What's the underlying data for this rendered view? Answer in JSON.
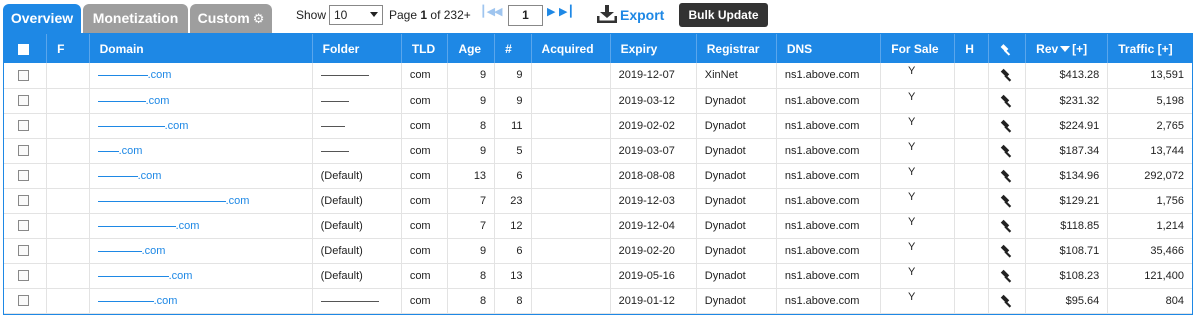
{
  "tabs": [
    {
      "label": "Overview",
      "active": true
    },
    {
      "label": "Monetization",
      "active": false
    },
    {
      "label": "Custom",
      "active": false
    }
  ],
  "toolbar": {
    "show_label": "Show",
    "show_value": "10",
    "page_prefix": "Page",
    "page_current": "1",
    "page_suffix": "of 232+",
    "page_input": "1",
    "export_label": "Export",
    "bulk_label": "Bulk Update"
  },
  "columns": [
    "F",
    "Domain",
    "Folder",
    "TLD",
    "Age",
    "#",
    "Acquired",
    "Expiry",
    "Registrar",
    "DNS",
    "For Sale",
    "H",
    "Rev",
    "[+]",
    "Traffic [+]"
  ],
  "rows": [
    {
      "domain_tld": ".com",
      "folder": "",
      "tld": "com",
      "age": "9",
      "count": "9",
      "acquired": "",
      "expiry": "2019-12-07",
      "registrar": "XinNet",
      "dns": "ns1.above.com",
      "for_sale": "Y",
      "rev": "$413.28",
      "traffic": "13,591"
    },
    {
      "domain_tld": ".com",
      "folder": "",
      "tld": "com",
      "age": "9",
      "count": "9",
      "acquired": "",
      "expiry": "2019-03-12",
      "registrar": "Dynadot",
      "dns": "ns1.above.com",
      "for_sale": "Y",
      "rev": "$231.32",
      "traffic": "5,198"
    },
    {
      "domain_tld": ".com",
      "folder": "",
      "tld": "com",
      "age": "8",
      "count": "11",
      "acquired": "",
      "expiry": "2019-02-02",
      "registrar": "Dynadot",
      "dns": "ns1.above.com",
      "for_sale": "Y",
      "rev": "$224.91",
      "traffic": "2,765"
    },
    {
      "domain_tld": ".com",
      "folder": "",
      "tld": "com",
      "age": "9",
      "count": "5",
      "acquired": "",
      "expiry": "2019-03-07",
      "registrar": "Dynadot",
      "dns": "ns1.above.com",
      "for_sale": "Y",
      "rev": "$187.34",
      "traffic": "13,744"
    },
    {
      "domain_tld": ".com",
      "folder": "(Default)",
      "tld": "com",
      "age": "13",
      "count": "6",
      "acquired": "",
      "expiry": "2018-08-08",
      "registrar": "Dynadot",
      "dns": "ns1.above.com",
      "for_sale": "Y",
      "rev": "$134.96",
      "traffic": "292,072"
    },
    {
      "domain_tld": ".com",
      "folder": "(Default)",
      "tld": "com",
      "age": "7",
      "count": "23",
      "acquired": "",
      "expiry": "2019-12-03",
      "registrar": "Dynadot",
      "dns": "ns1.above.com",
      "for_sale": "Y",
      "rev": "$129.21",
      "traffic": "1,756"
    },
    {
      "domain_tld": ".com",
      "folder": "(Default)",
      "tld": "com",
      "age": "7",
      "count": "12",
      "acquired": "",
      "expiry": "2019-12-04",
      "registrar": "Dynadot",
      "dns": "ns1.above.com",
      "for_sale": "Y",
      "rev": "$118.85",
      "traffic": "1,214"
    },
    {
      "domain_tld": ".com",
      "folder": "(Default)",
      "tld": "com",
      "age": "9",
      "count": "6",
      "acquired": "",
      "expiry": "2019-02-20",
      "registrar": "Dynadot",
      "dns": "ns1.above.com",
      "for_sale": "Y",
      "rev": "$108.71",
      "traffic": "35,466"
    },
    {
      "domain_tld": ".com",
      "folder": "(Default)",
      "tld": "com",
      "age": "8",
      "count": "13",
      "acquired": "",
      "expiry": "2019-05-16",
      "registrar": "Dynadot",
      "dns": "ns1.above.com",
      "for_sale": "Y",
      "rev": "$108.23",
      "traffic": "121,400"
    },
    {
      "domain_tld": ".com",
      "folder": "",
      "tld": "com",
      "age": "8",
      "count": "8",
      "acquired": "",
      "expiry": "2019-01-12",
      "registrar": "Dynadot",
      "dns": "ns1.above.com",
      "for_sale": "Y",
      "rev": "$95.64",
      "traffic": "804"
    }
  ],
  "colors": {
    "accent": "#1e88e5",
    "tab_inactive": "#9e9e9e",
    "bulk_bg": "#333333"
  },
  "icons": [
    "gear-icon",
    "first-page-icon",
    "prev-page-icon",
    "next-page-icon",
    "last-page-icon",
    "download-icon",
    "gavel-icon",
    "sort-desc-icon"
  ]
}
